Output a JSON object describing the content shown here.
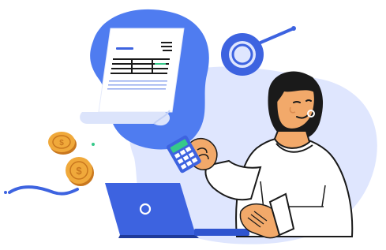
{
  "illustration": {
    "subject": "finance-accounting",
    "icons": [
      "invoice-icon",
      "magnifier-icon",
      "coin-icon",
      "calculator-icon",
      "laptop-icon"
    ]
  },
  "colors": {
    "background": "#ffffff",
    "blob_light": "#dfe6fe",
    "blob_primary": "#4f7cf0",
    "primary_blue": "#3d63e0",
    "navy": "#1f3a9a",
    "ink": "#1a1a1a",
    "skin": "#f2a96a",
    "skin_shadow": "#d98a4f",
    "coin_gold": "#f0a93b",
    "coin_dark": "#c9771e",
    "document_paper": "#ffffff",
    "document_fold": "#dce4fb",
    "calculator_screen": "#36c98a",
    "shirt": "#ffffff"
  }
}
